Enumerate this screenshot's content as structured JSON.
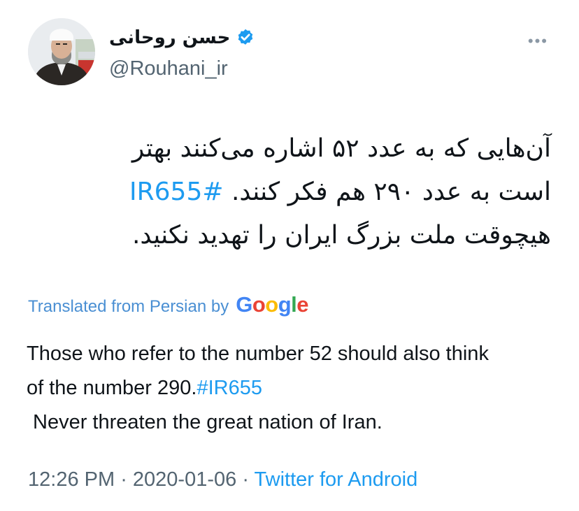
{
  "author": {
    "display_name": "حسن روحانی",
    "handle": "@Rouhani_ir",
    "verified": true
  },
  "tweet": {
    "persian_lines": [
      "آن‌هایی که به عدد ۵۲ اشاره می‌کنند بهتر",
      "است به عدد ۲۹۰ هم فکر کنند.",
      "هیچوقت ملت بزرگ ایران را تهدید نکنید."
    ],
    "hashtag": "#IR655",
    "translated_label": "Translated from Persian by",
    "google_letters": [
      "G",
      "o",
      "o",
      "g",
      "l",
      "e"
    ],
    "translation_line1": "Those who refer to the number 52 should also think",
    "translation_line2": "of the number 290.",
    "translation_line3": "Never threaten the great nation of Iran."
  },
  "meta": {
    "time": "12:26 PM",
    "separator": " · ",
    "date": "2020-01-06",
    "source": "Twitter for Android"
  },
  "colors": {
    "link": "#1d9bf0",
    "secondary_text": "#536471",
    "translated_label": "#4a8fd3",
    "google": [
      "#4285F4",
      "#EA4335",
      "#FBBC05",
      "#4285F4",
      "#34A853",
      "#EA4335"
    ]
  },
  "icons": {
    "verified": "verified-badge-icon",
    "more": "more-options-icon"
  }
}
